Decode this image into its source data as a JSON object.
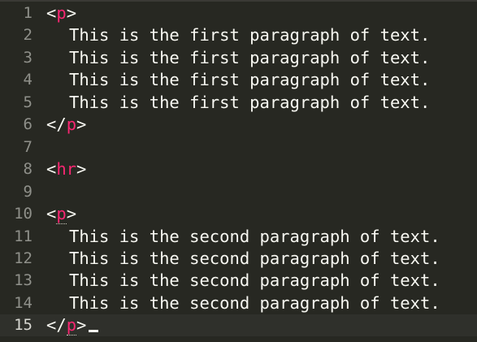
{
  "editor": {
    "lines": [
      {
        "number": "1",
        "kind": "tag",
        "open": "<",
        "tag": "p",
        "close": ">"
      },
      {
        "number": "2",
        "kind": "text",
        "text": "This is the first paragraph of text."
      },
      {
        "number": "3",
        "kind": "text",
        "text": "This is the first paragraph of text."
      },
      {
        "number": "4",
        "kind": "text",
        "text": "This is the first paragraph of text."
      },
      {
        "number": "5",
        "kind": "text",
        "text": "This is the first paragraph of text."
      },
      {
        "number": "6",
        "kind": "tag",
        "open": "</",
        "tag": "p",
        "close": ">"
      },
      {
        "number": "7",
        "kind": "empty"
      },
      {
        "number": "8",
        "kind": "tag",
        "open": "<",
        "tag": "hr",
        "close": ">"
      },
      {
        "number": "9",
        "kind": "empty"
      },
      {
        "number": "10",
        "kind": "tag",
        "open": "<",
        "tag": "p",
        "close": ">",
        "matched": true
      },
      {
        "number": "11",
        "kind": "text",
        "text": "This is the second paragraph of text."
      },
      {
        "number": "12",
        "kind": "text",
        "text": "This is the second paragraph of text."
      },
      {
        "number": "13",
        "kind": "text",
        "text": "This is the second paragraph of text."
      },
      {
        "number": "14",
        "kind": "text",
        "text": "This is the second paragraph of text."
      },
      {
        "number": "15",
        "kind": "tag",
        "open": "</",
        "tag": "p",
        "close": ">",
        "matched": true,
        "current": true,
        "cursor": true
      }
    ]
  },
  "colors": {
    "background": "#272822",
    "current_line": "#2f302b",
    "tag": "#f92672",
    "text": "#f8f8f2",
    "line_number": "#8f908a"
  }
}
